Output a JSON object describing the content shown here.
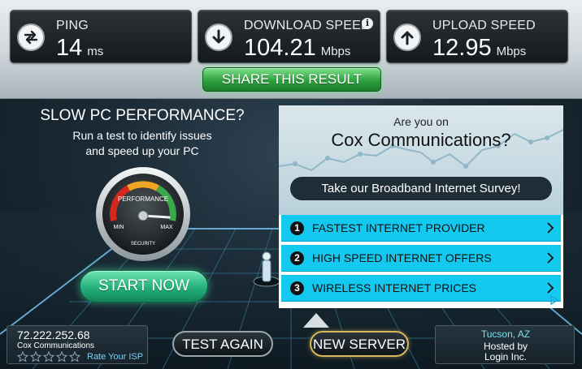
{
  "stats": {
    "ping": {
      "label": "PING",
      "value": "14",
      "unit": "ms"
    },
    "download": {
      "label": "DOWNLOAD SPEED",
      "value": "104.21",
      "unit": "Mbps",
      "info": "i"
    },
    "upload": {
      "label": "UPLOAD SPEED",
      "value": "12.95",
      "unit": "Mbps"
    }
  },
  "share_label": "SHARE THIS RESULT",
  "promo": {
    "title": "SLOW PC PERFORMANCE?",
    "subtitle_line1": "Run a test to identify issues",
    "subtitle_line2": "and speed up your PC",
    "gauge_label": "PERFORMANCE",
    "gauge_min": "MIN",
    "gauge_max": "MAX",
    "gauge_bottom": "SECURITY",
    "start_label": "START NOW"
  },
  "ad": {
    "question_line1": "Are you on",
    "question_line2": "Cox Communications?",
    "survey_label": "Take our Broadband Internet Survey!",
    "items": [
      {
        "num": "1",
        "label": "FASTEST INTERNET PROVIDER"
      },
      {
        "num": "2",
        "label": "HIGH SPEED INTERNET OFFERS"
      },
      {
        "num": "3",
        "label": "WIRELESS INTERNET PRICES"
      }
    ]
  },
  "isp": {
    "ip": "72.222.252.68",
    "name": "Cox Communications",
    "rate_label": "Rate Your ISP",
    "stars": 0
  },
  "buttons": {
    "test_again": "TEST AGAIN",
    "new_server": "NEW SERVER"
  },
  "host": {
    "location": "Tucson, AZ",
    "hosted_by": "Hosted by",
    "name": "Login Inc."
  },
  "colors": {
    "share_green": "#2fa13f",
    "start_green": "#24b07c",
    "ad_cyan": "#14c9f0",
    "location_cyan": "#7fe0ea",
    "new_server_gold": "#d8b75a"
  }
}
